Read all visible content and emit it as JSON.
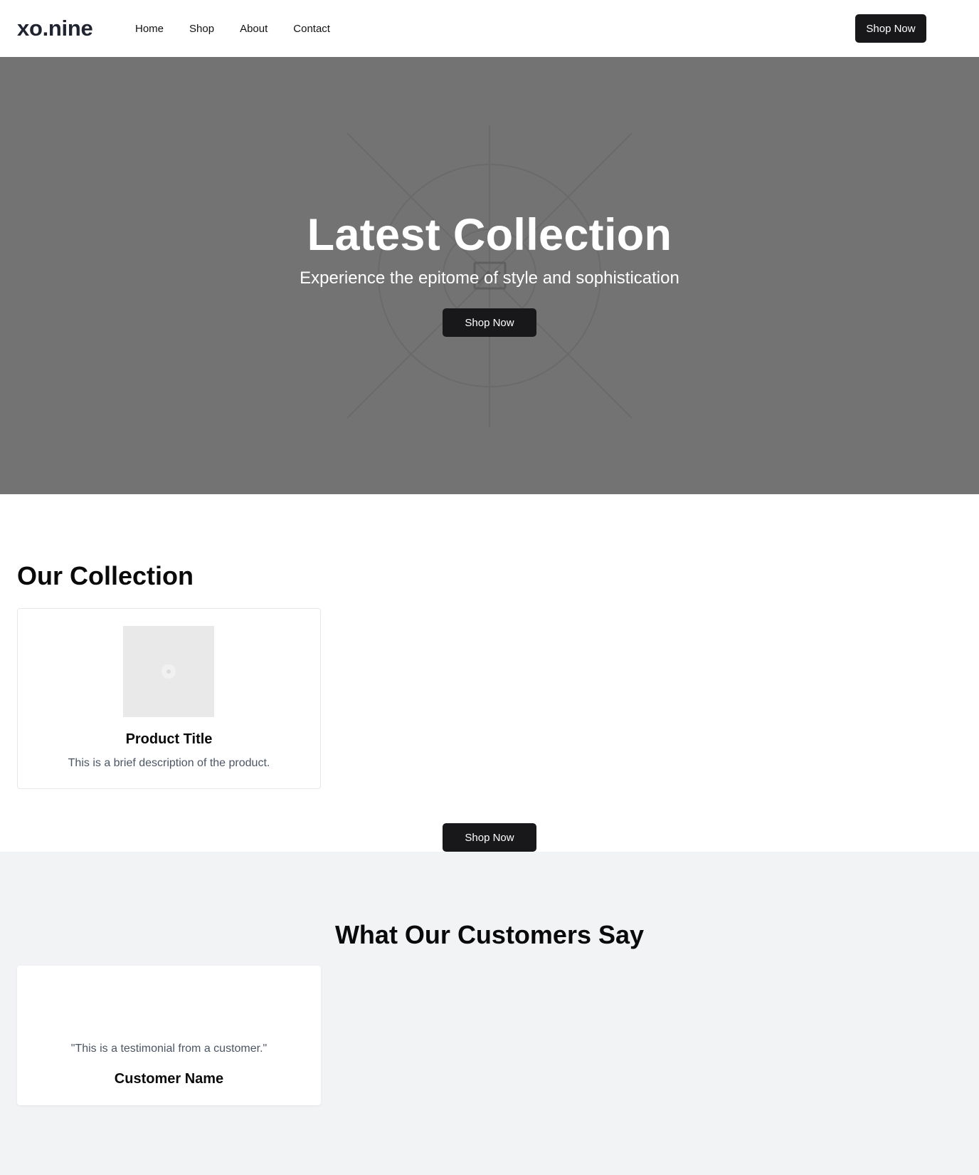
{
  "header": {
    "logo": "xo.nine",
    "nav": [
      "Home",
      "Shop",
      "About",
      "Contact"
    ],
    "cta_label": "Shop Now"
  },
  "hero": {
    "title": "Latest Collection",
    "subtitle": "Experience the epitome of style and sophistication",
    "cta_label": "Shop Now",
    "background_color": "#737373",
    "image_placeholder_icon": "image-icon"
  },
  "collection": {
    "title": "Our Collection",
    "products": [
      {
        "title": "Product Title",
        "description": "This is a brief description of the product.",
        "image_placeholder_icon": "image-icon"
      }
    ],
    "cta_label": "Shop Now"
  },
  "testimonials": {
    "title": "What Our Customers Say",
    "items": [
      {
        "quote": "\"This is a testimonial from a customer.\"",
        "name": "Customer Name"
      }
    ],
    "background_color": "#f2f3f5"
  },
  "colors": {
    "button": "#18181b",
    "button_text": "#ffffff",
    "muted_text": "#4b5563"
  }
}
